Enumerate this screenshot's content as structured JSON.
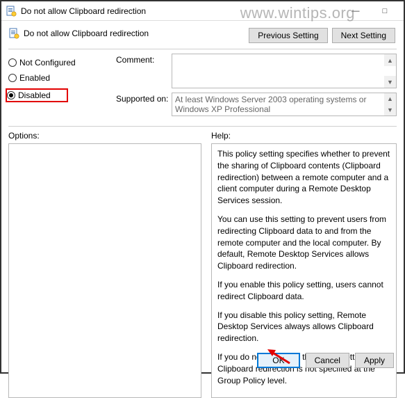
{
  "window": {
    "title": "Do not allow Clipboard redirection",
    "heading": "Do not allow Clipboard redirection"
  },
  "nav": {
    "previous": "Previous Setting",
    "next": "Next Setting"
  },
  "radios": {
    "not_configured": "Not Configured",
    "enabled": "Enabled",
    "disabled": "Disabled",
    "selected": "disabled"
  },
  "fields": {
    "comment_label": "Comment:",
    "comment_value": "",
    "supported_label": "Supported on:",
    "supported_value": "At least Windows Server 2003 operating systems or Windows XP Professional"
  },
  "columns": {
    "options_label": "Options:",
    "help_label": "Help:"
  },
  "help": {
    "p1": "This policy setting specifies whether to prevent the sharing of Clipboard contents (Clipboard redirection) between a remote computer and a client computer during a Remote Desktop Services session.",
    "p2": "You can use this setting to prevent users from redirecting Clipboard data to and from the remote computer and the local computer. By default, Remote Desktop Services allows Clipboard redirection.",
    "p3": "If you enable this policy setting, users cannot redirect Clipboard data.",
    "p4": "If you disable this policy setting, Remote Desktop Services always allows Clipboard redirection.",
    "p5": "If you do not configure this policy setting, Clipboard redirection is not specified at the Group Policy level."
  },
  "buttons": {
    "ok": "OK",
    "cancel": "Cancel",
    "apply": "Apply"
  },
  "watermark": "www.wintips.org"
}
